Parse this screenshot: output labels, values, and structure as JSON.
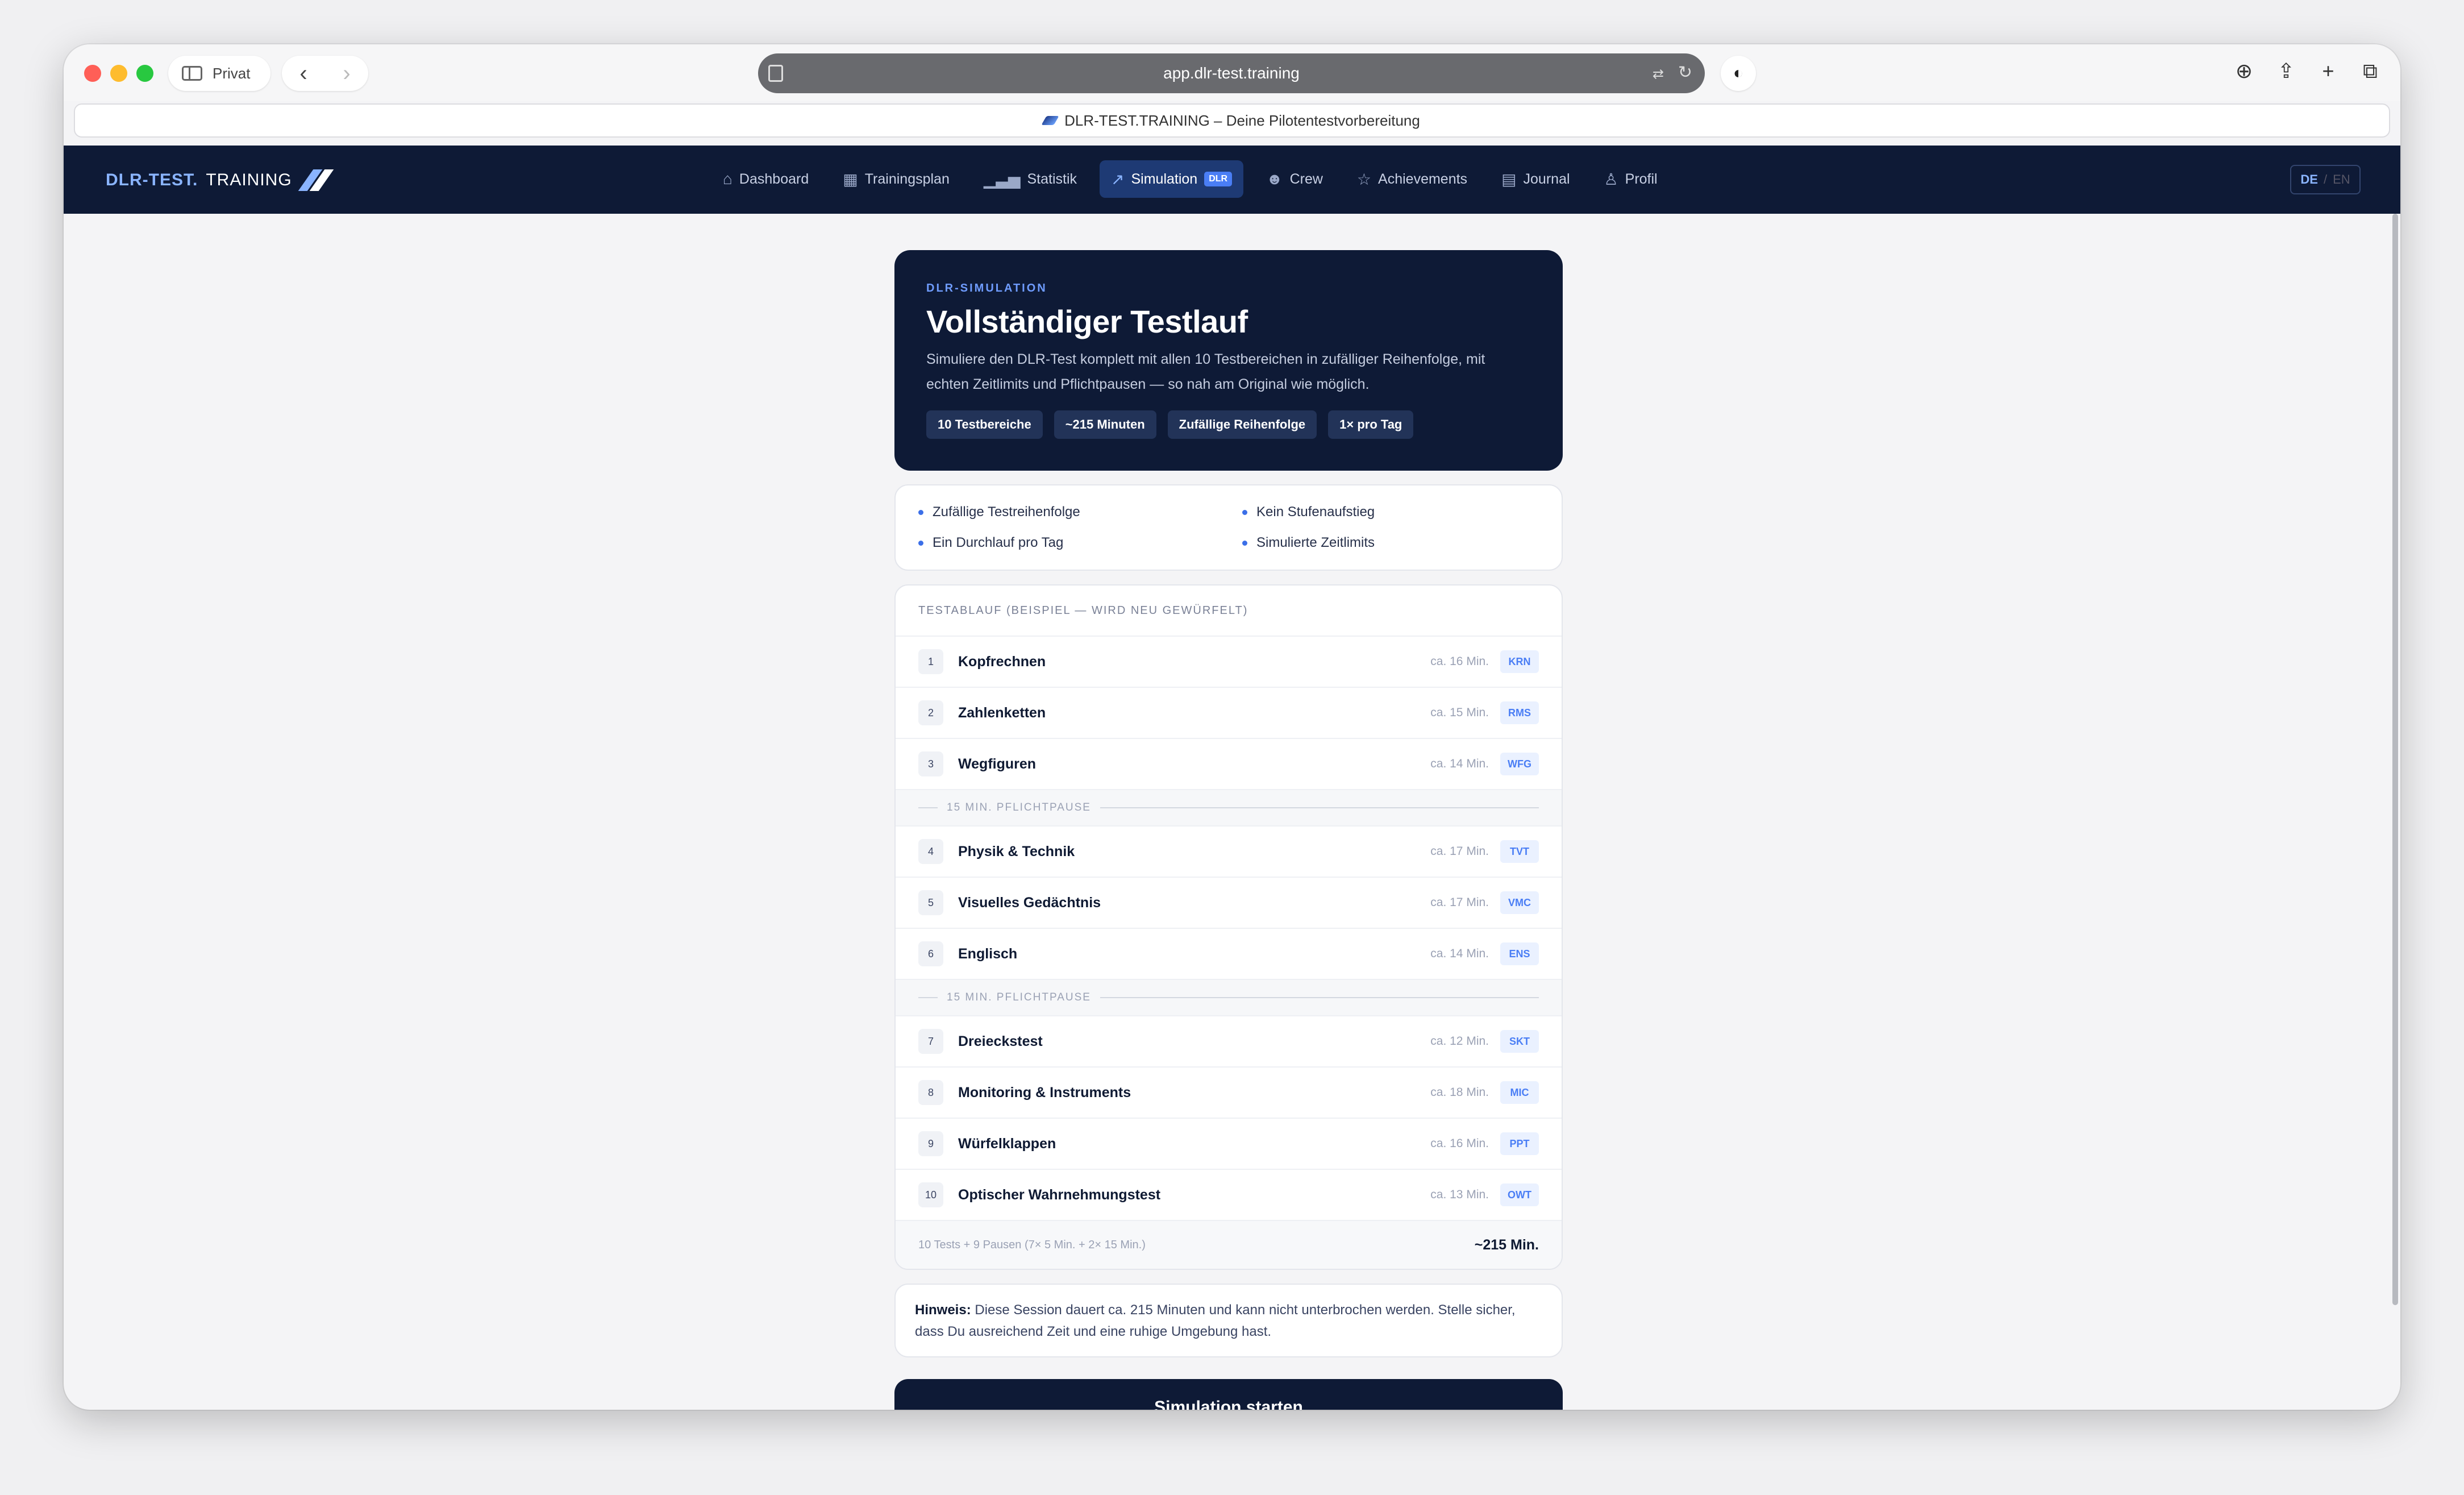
{
  "browser": {
    "private_label": "Privat",
    "url": "app.dlr-test.training",
    "tab_title": "DLR-TEST.TRAINING – Deine Pilotentestvorbereitung"
  },
  "app": {
    "brand_part1": "DLR-TEST.",
    "brand_part2": "TRAINING",
    "nav": [
      {
        "label": "Dashboard"
      },
      {
        "label": "Trainingsplan"
      },
      {
        "label": "Statistik"
      },
      {
        "label": "Simulation",
        "badge": "DLR"
      },
      {
        "label": "Crew"
      },
      {
        "label": "Achievements"
      },
      {
        "label": "Journal"
      },
      {
        "label": "Profil"
      }
    ],
    "lang": {
      "de": "DE",
      "sep": "/",
      "en": "EN"
    }
  },
  "hero": {
    "eyebrow": "DLR-SIMULATION",
    "title": "Vollständiger Testlauf",
    "description": "Simuliere den DLR-Test komplett mit allen 10 Testbereichen in zufälliger Reihenfolge, mit echten Zeitlimits und Pflichtpausen — so nah am Original wie möglich.",
    "chips": [
      "10 Testbereiche",
      "~215 Minuten",
      "Zufällige Reihenfolge",
      "1× pro Tag"
    ]
  },
  "features": [
    "Zufällige Testreihenfolge",
    "Kein Stufenaufstieg",
    "Ein Durchlauf pro Tag",
    "Simulierte Zeitlimits"
  ],
  "testrun": {
    "heading": "TESTABLAUF (BEISPIEL — WIRD NEU GEWÜRFELT)",
    "pause_label": "15 MIN. PFLICHTPAUSE",
    "tests": [
      {
        "num": "1",
        "name": "Kopfrechnen",
        "duration": "ca. 16 Min.",
        "code": "KRN"
      },
      {
        "num": "2",
        "name": "Zahlenketten",
        "duration": "ca. 15 Min.",
        "code": "RMS"
      },
      {
        "num": "3",
        "name": "Wegfiguren",
        "duration": "ca. 14 Min.",
        "code": "WFG"
      },
      {
        "num": "4",
        "name": "Physik & Technik",
        "duration": "ca. 17 Min.",
        "code": "TVT"
      },
      {
        "num": "5",
        "name": "Visuelles Gedächtnis",
        "duration": "ca. 17 Min.",
        "code": "VMC"
      },
      {
        "num": "6",
        "name": "Englisch",
        "duration": "ca. 14 Min.",
        "code": "ENS"
      },
      {
        "num": "7",
        "name": "Dreieckstest",
        "duration": "ca. 12 Min.",
        "code": "SKT"
      },
      {
        "num": "8",
        "name": "Monitoring & Instruments",
        "duration": "ca. 18 Min.",
        "code": "MIC"
      },
      {
        "num": "9",
        "name": "Würfelklappen",
        "duration": "ca. 16 Min.",
        "code": "PPT"
      },
      {
        "num": "10",
        "name": "Optischer Wahrnehmungstest",
        "duration": "ca. 13 Min.",
        "code": "OWT"
      }
    ],
    "footer_left": "10 Tests + 9 Pausen (7× 5 Min. + 2× 15 Min.)",
    "footer_right": "~215 Min."
  },
  "hint": {
    "label": "Hinweis:",
    "text": " Diese Session dauert ca. 215 Minuten und kann nicht unterbrochen werden. Stelle sicher, dass Du ausreichend Zeit und eine ruhige Umgebung hast."
  },
  "start_button": "Simulation starten"
}
